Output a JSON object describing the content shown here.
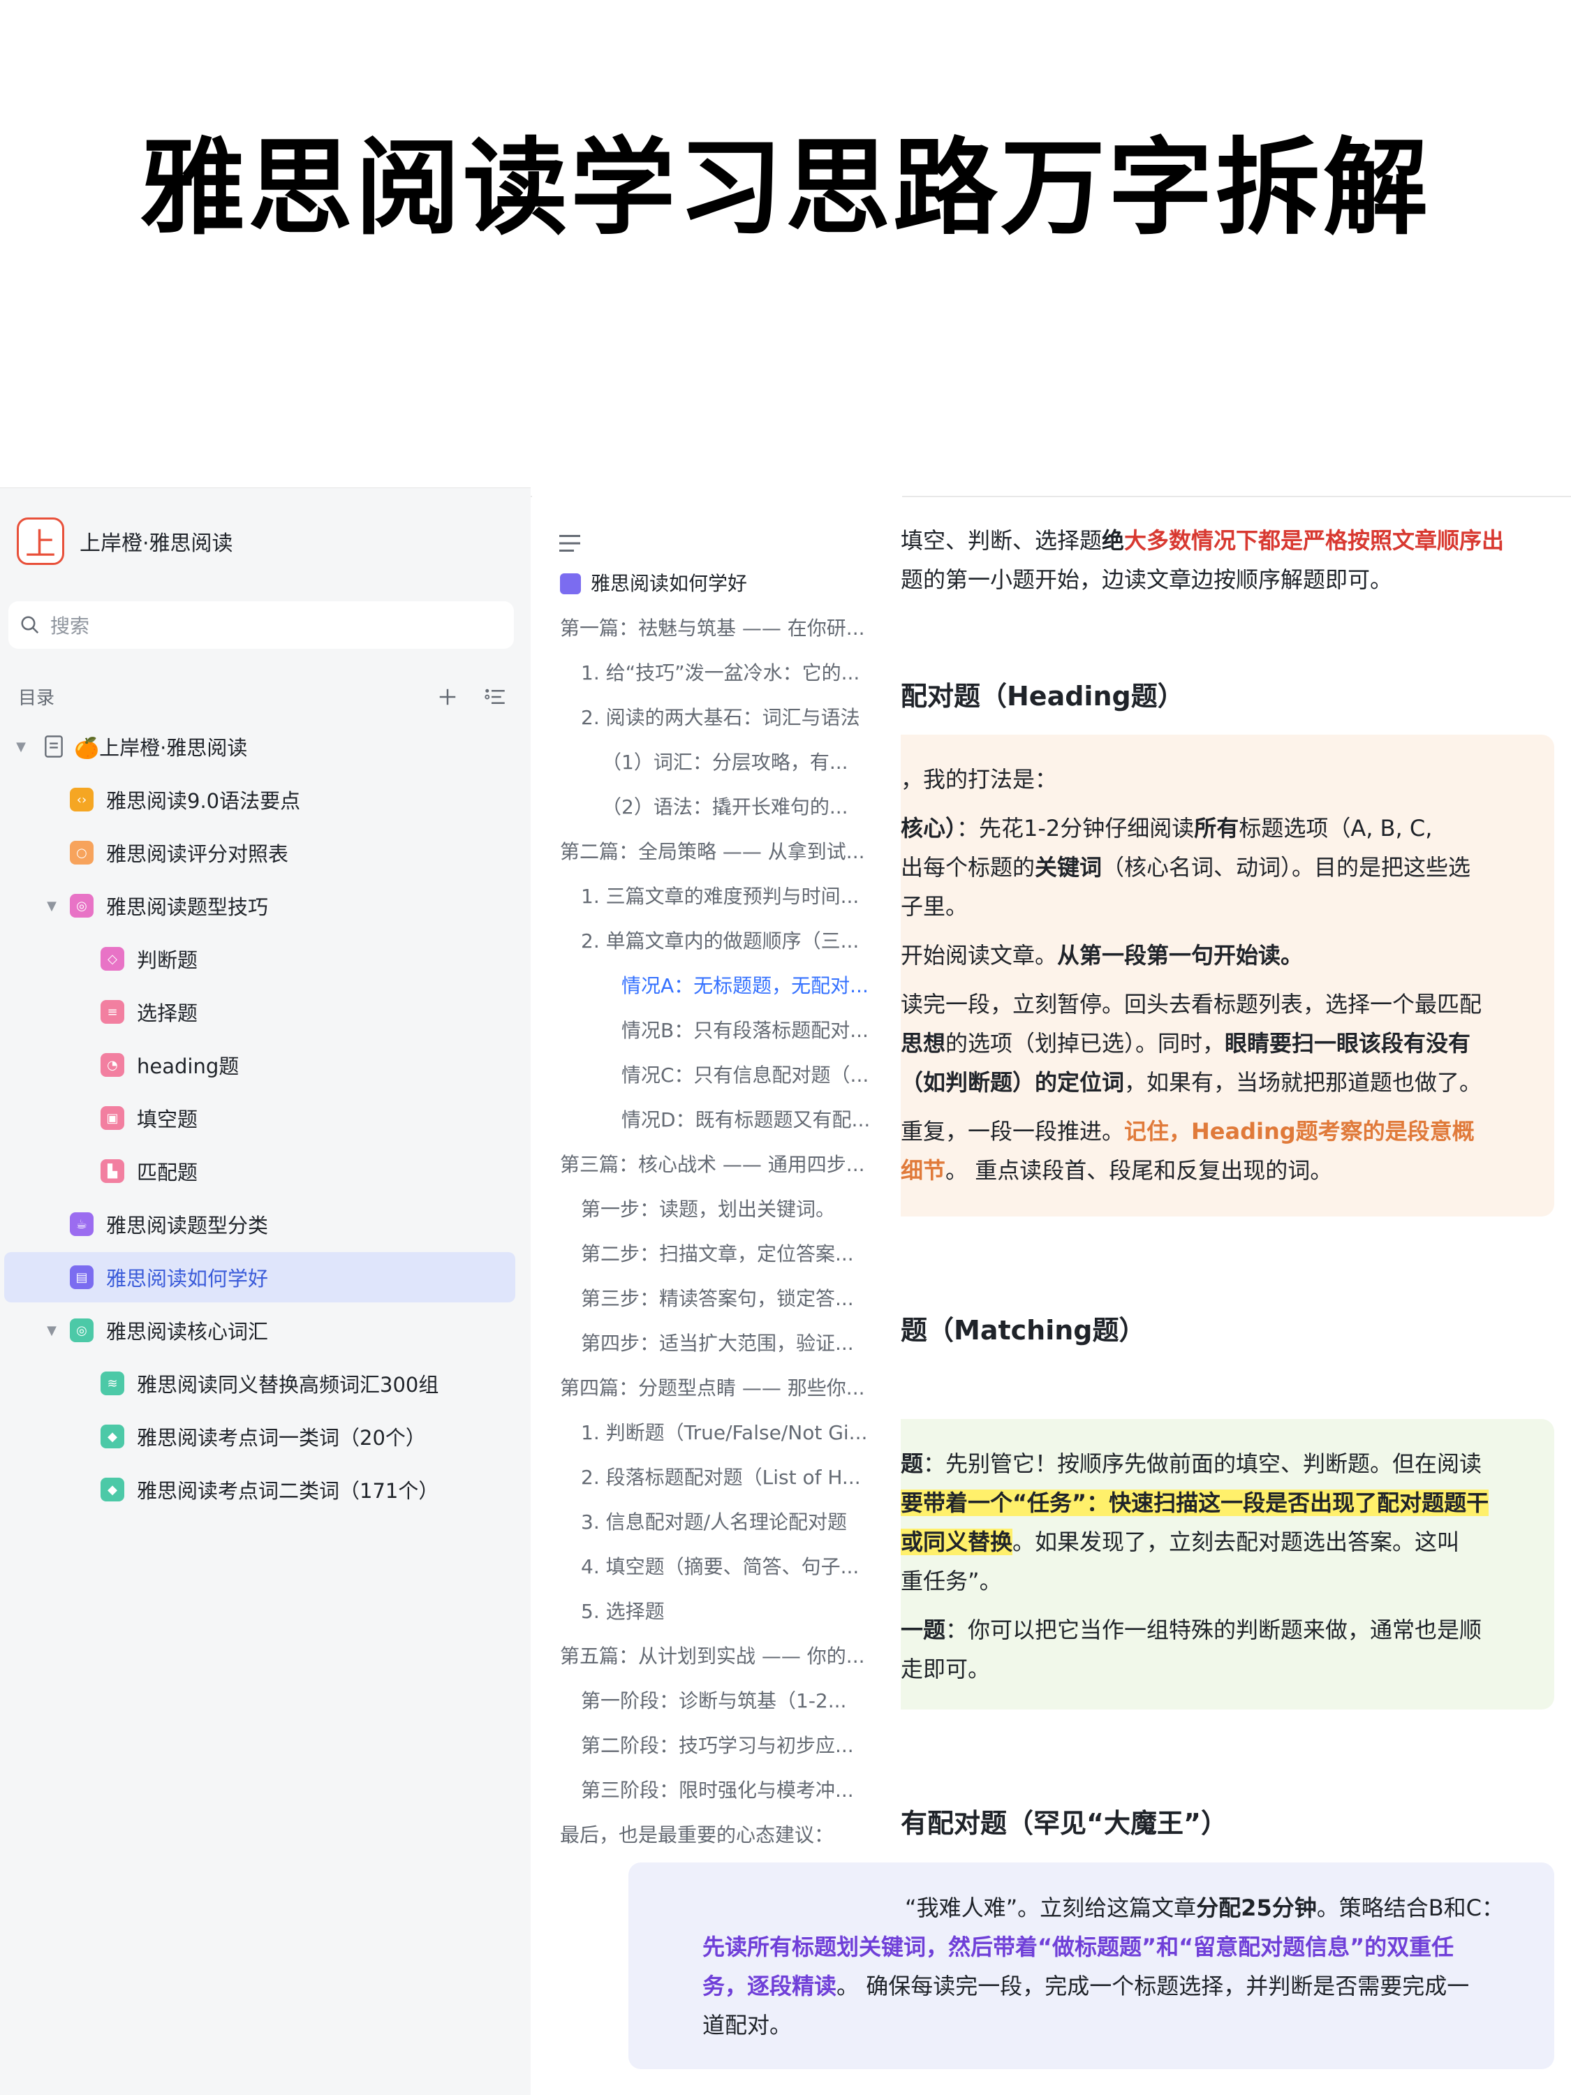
{
  "page_title": "雅思阅读学习思路万字拆解",
  "sidebar": {
    "brand_logo": "上",
    "brand_name": "上岸橙·雅思阅读",
    "search_placeholder": "搜索",
    "toc_label": "目录",
    "items": [
      {
        "label": "🍊上岸橙·雅思阅读",
        "icon": "doc-icon",
        "color": "#8f959e"
      },
      {
        "label": "雅思阅读9.0语法要点",
        "icon": "code-icon",
        "color": "#f5a623"
      },
      {
        "label": "雅思阅读评分对照表",
        "icon": "bulb-icon",
        "color": "#f7a35c"
      },
      {
        "label": "雅思阅读题型技巧",
        "icon": "palette-icon",
        "color": "#e873c6"
      },
      {
        "label": "判断题",
        "icon": "cube-icon",
        "color": "#e873c6"
      },
      {
        "label": "选择题",
        "icon": "list-icon",
        "color": "#f27fa0"
      },
      {
        "label": "heading题",
        "icon": "clock-icon",
        "color": "#f27fa0"
      },
      {
        "label": "填空题",
        "icon": "camera-icon",
        "color": "#f27fa0"
      },
      {
        "label": "匹配题",
        "icon": "chart-icon",
        "color": "#f27fa0"
      },
      {
        "label": "雅思阅读题型分类",
        "icon": "cup-icon",
        "color": "#9b6cf0"
      },
      {
        "label": "雅思阅读如何学好",
        "icon": "board-icon",
        "color": "#7b6cf0"
      },
      {
        "label": "雅思阅读核心词汇",
        "icon": "target-icon",
        "color": "#4cc9a7"
      },
      {
        "label": "雅思阅读同义替换高频词汇300组",
        "icon": "layers-icon",
        "color": "#4cc9a7"
      },
      {
        "label": "雅思阅读考点词一类词（20个）",
        "icon": "tag-icon",
        "color": "#4cc9a7"
      },
      {
        "label": "雅思阅读考点词二类词（171个）",
        "icon": "tag-icon",
        "color": "#4cc9a7"
      }
    ]
  },
  "outline": {
    "root": "雅思阅读如何学好",
    "items": [
      "第一篇：祛魅与筑基 —— 在你研...",
      "1. 给“技巧”泼一盆冷水：它的...",
      "2. 阅读的两大基石：词汇与语法",
      "（1）词汇：分层攻略，有...",
      "（2）语法：撬开长难句的...",
      "第二篇：全局策略 —— 从拿到试...",
      "1. 三篇文章的难度预判与时间...",
      "2. 单篇文章内的做题顺序（三...",
      "情况A：无标题题，无配对...",
      "情况B：只有段落标题配对...",
      "情况C：只有信息配对题（...",
      "情况D：既有标题题又有配...",
      "第三篇：核心战术 —— 通用四步...",
      "第一步：读题，划出关键词。",
      "第二步：扫描文章，定位答案...",
      "第三步：精读答案句，锁定答...",
      "第四步：适当扩大范围，验证...",
      "第四篇：分题型点睛 —— 那些你...",
      "1. 判断题（True/False/Not Gi...",
      "2. 段落标题配对题（List of H...",
      "3. 信息配对题/人名理论配对题",
      "4. 填空题（摘要、简答、句子...",
      "5. 选择题",
      "第五篇：从计划到实战 —— 你的...",
      "第一阶段：诊断与筑基（1-2...",
      "第二阶段：技巧学习与初步应...",
      "第三阶段：限时强化与模考冲...",
      "最后，也是最重要的心态建议："
    ]
  },
  "document": {
    "p1a": "填空、判断、选择题",
    "p1b": "绝",
    "p1c": "大多数情况下都是严格按照文章顺序出",
    "p2": "题的第一小题开始，边读文章边按顺序解题即可。",
    "h1": "配对题（Heading题）",
    "b1_l1": "，我的打法是：",
    "b1_l2a": "核心）",
    "b1_l2b": "：先花1-2分钟仔细阅读",
    "b1_l2c": "所有",
    "b1_l2d": "标题选项（A, B, C,",
    "b1_l3a": "出每个标题的",
    "b1_l3b": "关键词",
    "b1_l3c": "（核心名词、动词）。目的是把这些选",
    "b1_l4": "子里。",
    "b1_l5a": "开始阅读文章。",
    "b1_l5b": "从第一段第一句开始读。",
    "b1_l6": "读完一段，立刻暂停。回头去看标题列表，选择一个最匹配",
    "b1_l7a": "思想",
    "b1_l7b": "的选项（划掉已选）。同时，",
    "b1_l7c": "眼睛要扫一眼该段有没有",
    "b1_l8a": "（如判断题）的定位词",
    "b1_l8b": "，如果有，当场就把那道题也做了。",
    "b1_l9a": "重复，一段一段推进。",
    "b1_l9b": "记住，Heading题考察的是段意概",
    "b1_l10a": "细节",
    "b1_l10b": "。 重点读段首、段尾和反复出现的词。",
    "h2": "题（Matching题）",
    "b2_l1a": "题",
    "b2_l1b": "：先别管它！按顺序先做前面的填空、判断题。但在阅读",
    "b2_l2": "要带着一个“任务”：快速扫描这一段是否出现了配对题题干",
    "b2_l3a": "或同义替换",
    "b2_l3b": "。如果发现了，立刻去配对题选出答案。这叫",
    "b2_l4": "重任务”。",
    "b2_l5a": "一题",
    "b2_l5b": "：你可以把它当作一组特殊的判断题来做，通常也是顺",
    "b2_l6": "走即可。",
    "h3": "有配对题（罕见“大魔王”）",
    "b3_l1a": "“我难人难”。立刻给这篇文章",
    "b3_l1b": "分配25分钟",
    "b3_l1c": "。策略结合B和C：",
    "b3_l2": "先读所有标题划关键词，然后带着“做标题题”和“留意配对题信息”的双重任",
    "b3_l3a": "务，逐段精读",
    "b3_l3b": "。 确保每读完一段，完成一个标题选择，并判断是否需要完成一",
    "b3_l4": "道配对。"
  }
}
